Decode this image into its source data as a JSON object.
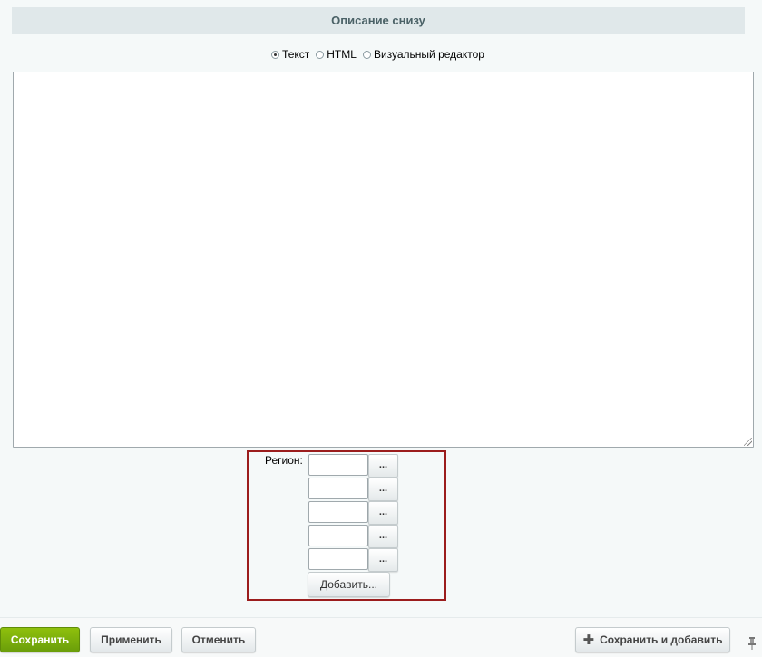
{
  "section": {
    "title": "Описание снизу"
  },
  "editor_mode": {
    "options": [
      {
        "label": "Текст",
        "checked": true
      },
      {
        "label": "HTML",
        "checked": false
      },
      {
        "label": "Визуальный редактор",
        "checked": false
      }
    ]
  },
  "description": {
    "value": ""
  },
  "region": {
    "label": "Регион:",
    "fields": [
      "",
      "",
      "",
      "",
      ""
    ],
    "pick_label": "...",
    "add_label": "Добавить..."
  },
  "footer": {
    "save_label": "Сохранить",
    "apply_label": "Применить",
    "cancel_label": "Отменить",
    "save_add_label": "Сохранить и добавить",
    "save_add_icon": "plus-icon",
    "pin_icon": "pin-icon",
    "colors": {
      "save_bg": "#7cb10b",
      "accent_border": "#9b1d1d"
    }
  }
}
